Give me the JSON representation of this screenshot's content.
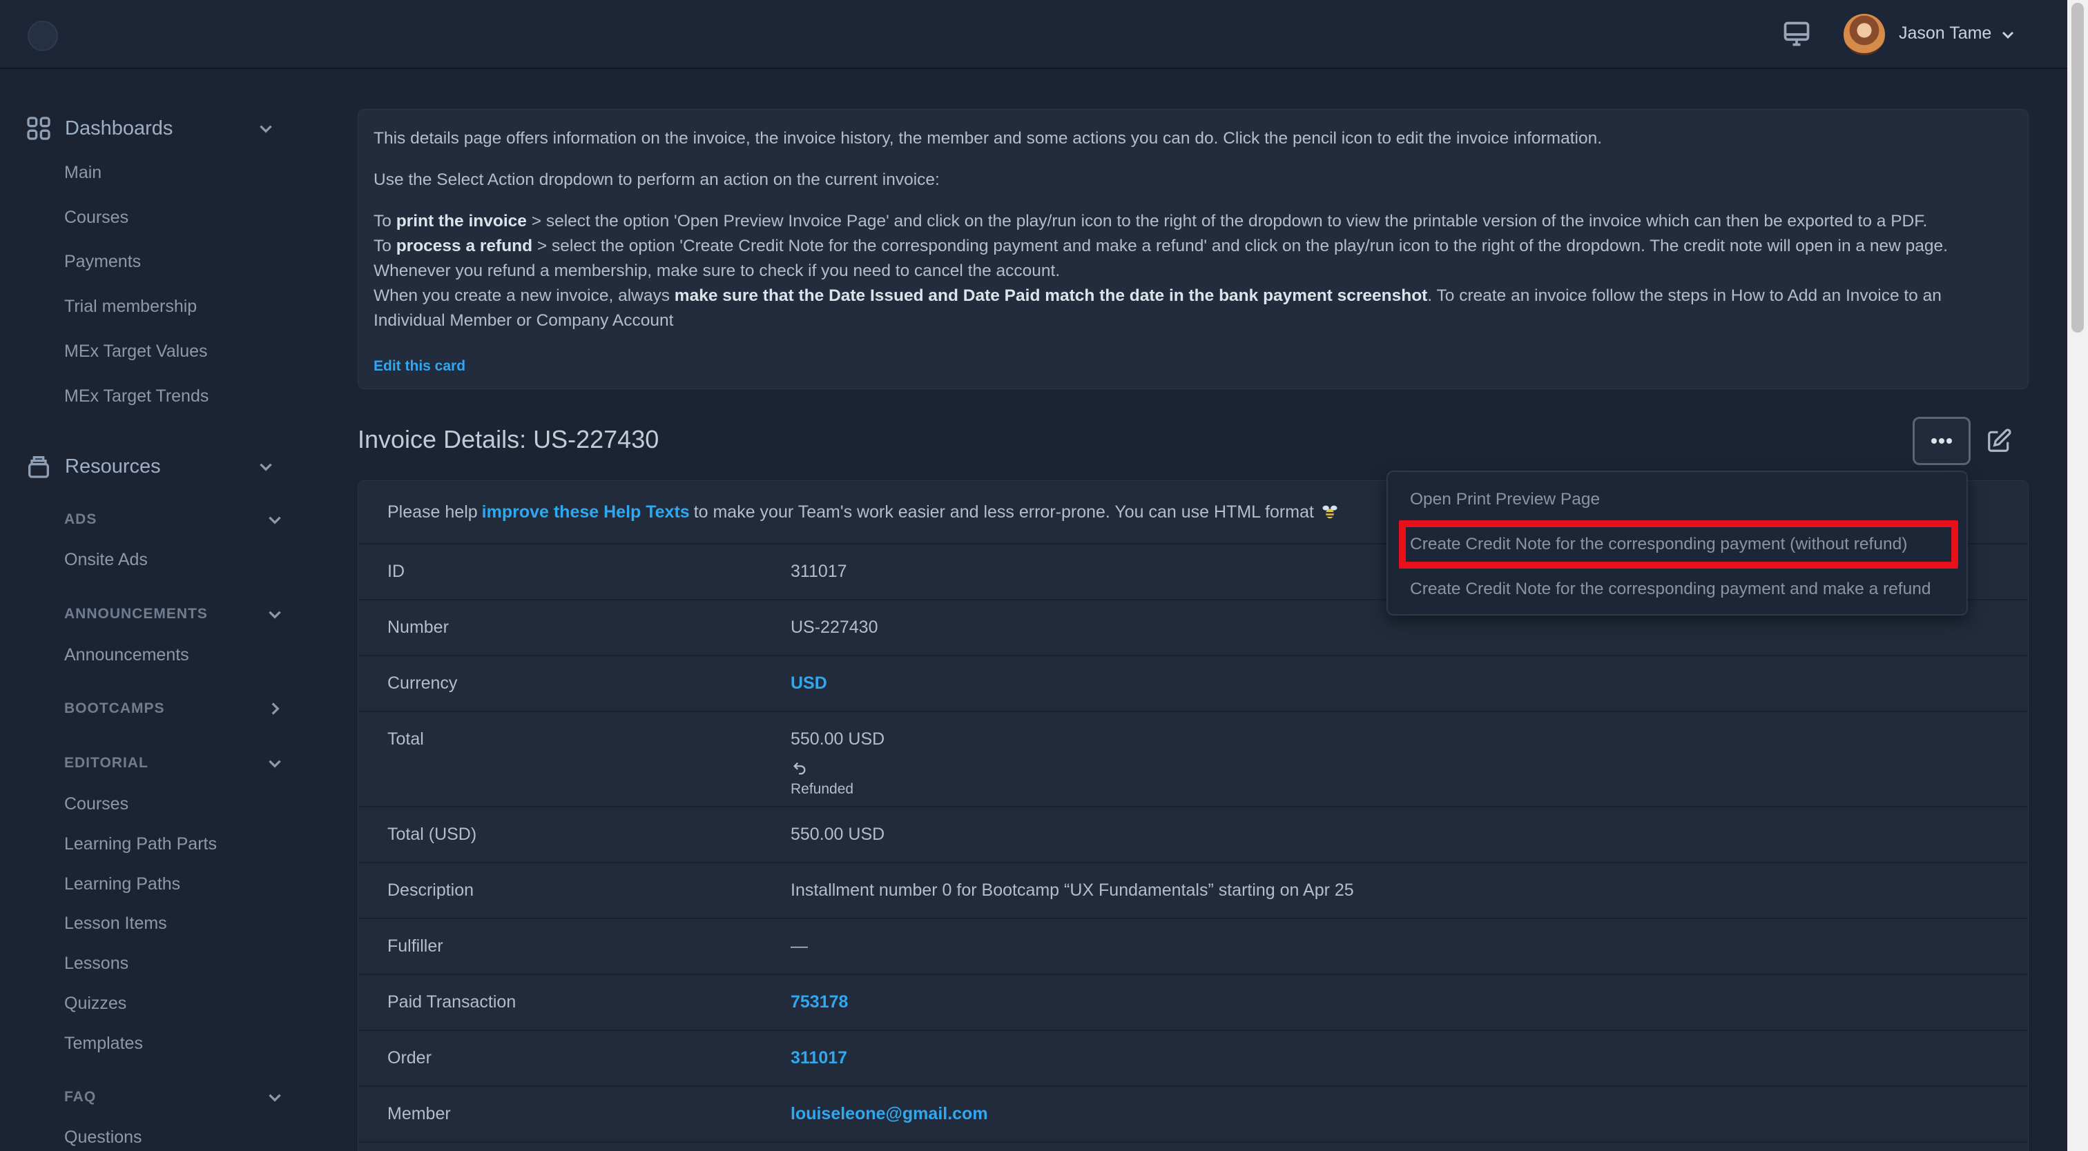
{
  "header": {
    "user_name": "Jason Tame"
  },
  "sidebar": {
    "dashboards": {
      "label": "Dashboards",
      "items": [
        "Main",
        "Courses",
        "Payments",
        "Trial membership",
        "MEx Target Values",
        "MEx Target Trends"
      ]
    },
    "resources": {
      "label": "Resources",
      "groups": {
        "ads": {
          "label": "ADS",
          "items": [
            "Onsite Ads"
          ]
        },
        "announcements": {
          "label": "ANNOUNCEMENTS",
          "items": [
            "Announcements"
          ]
        },
        "bootcamps": {
          "label": "BOOTCAMPS"
        },
        "editorial": {
          "label": "EDITORIAL",
          "items": [
            "Courses",
            "Learning Path Parts",
            "Learning Paths",
            "Lesson Items",
            "Lessons",
            "Quizzes",
            "Templates"
          ]
        },
        "faq": {
          "label": "FAQ",
          "items": [
            "Questions"
          ]
        }
      }
    }
  },
  "help_card": {
    "intro": "This details page offers information on the invoice, the invoice history, the member and some actions you can do. Click the pencil icon to edit the invoice information.",
    "select_action": "Use the Select Action dropdown to perform an action on the current invoice:",
    "print_pre": "To ",
    "print_bold": "print the invoice",
    "print_post": " > select the option 'Open Preview Invoice Page' and click on the play/run icon to the right of the dropdown to view the printable version of the invoice which can then be exported to a PDF.",
    "refund_pre": "To ",
    "refund_bold": "process a refund",
    "refund_post": " > select the option 'Create Credit Note for the corresponding payment and make a refund' and click on the play/run icon to the right of the dropdown. The credit note will open in a new page.",
    "membership": "Whenever you refund a membership, make sure to check if you need to cancel the account.",
    "new_pre": "When you create a new invoice, always ",
    "new_bold": "make sure that the Date Issued and Date Paid match the date in the bank payment screenshot",
    "new_post": ". To create an invoice follow the steps in How to Add an Invoice to an Individual Member or Company Account",
    "edit_link": "Edit this card"
  },
  "page_title": "Invoice Details: US-227430",
  "help_texts": {
    "pre": "Please help",
    "link": "improve these Help Texts",
    "post": "to make your Team's work easier and less error-prone. You can use HTML format"
  },
  "details": {
    "id": {
      "label": "ID",
      "value": "311017"
    },
    "number": {
      "label": "Number",
      "value": "US-227430"
    },
    "currency": {
      "label": "Currency",
      "value": "USD"
    },
    "total": {
      "label": "Total",
      "value": "550.00 USD",
      "status": "Refunded"
    },
    "total_usd": {
      "label": "Total (USD)",
      "value": "550.00 USD"
    },
    "description": {
      "label": "Description",
      "value": "Installment number 0 for Bootcamp “UX Fundamentals” starting on Apr 25"
    },
    "fulfiller": {
      "label": "Fulfiller",
      "value": "—"
    },
    "paid_transaction": {
      "label": "Paid Transaction",
      "value": "753178"
    },
    "order": {
      "label": "Order",
      "value": "311017"
    },
    "member": {
      "label": "Member",
      "value": "louiseleone@gmail.com"
    }
  },
  "dropdown": {
    "items": [
      "Open Print Preview Page",
      "Create Credit Note for the corresponding payment (without refund)",
      "Create Credit Note for the corresponding payment and make a refund"
    ],
    "highlighted_index": 1
  },
  "colors": {
    "accent": "#2fa8f0",
    "highlight": "#e8101a",
    "background": "#1c2434"
  }
}
